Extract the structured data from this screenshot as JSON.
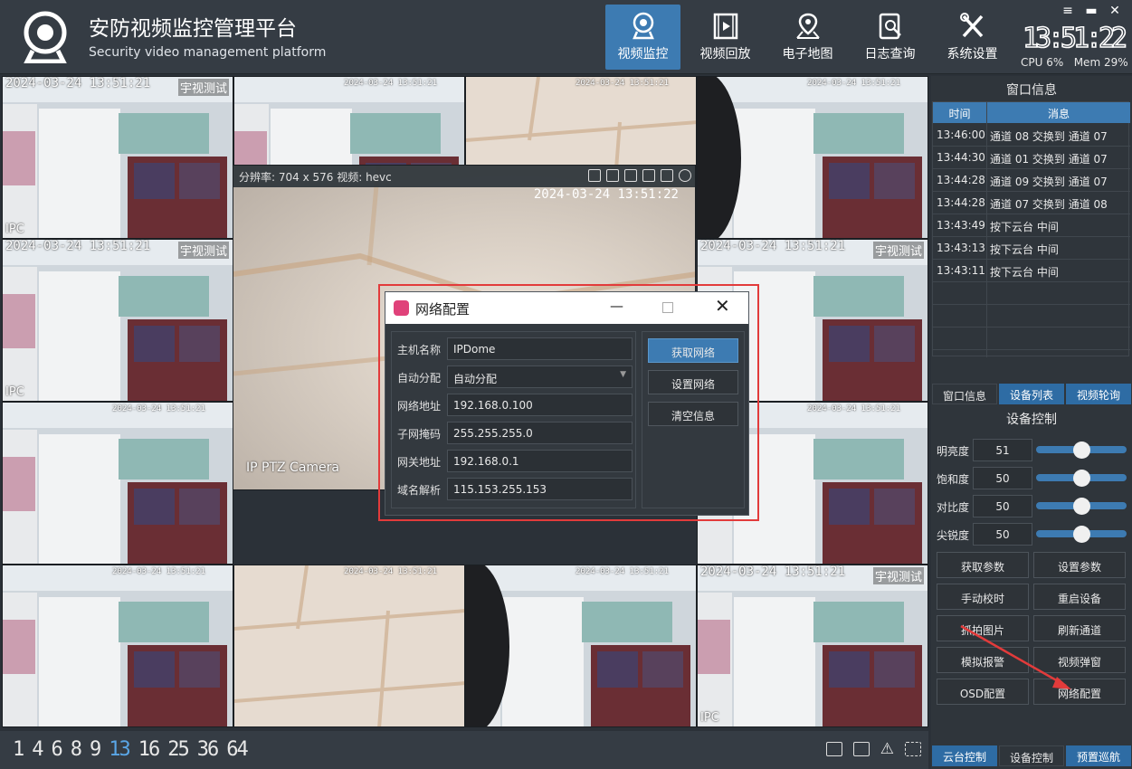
{
  "app": {
    "title": "安防视频监控管理平台",
    "subtitle": "Security video management platform"
  },
  "nav": [
    {
      "label": "视频监控",
      "icon": "camera-icon",
      "active": true
    },
    {
      "label": "视频回放",
      "icon": "film-icon",
      "active": false
    },
    {
      "label": "电子地图",
      "icon": "map-icon",
      "active": false
    },
    {
      "label": "日志查询",
      "icon": "log-search-icon",
      "active": false
    },
    {
      "label": "系统设置",
      "icon": "tools-icon",
      "active": false
    }
  ],
  "status": {
    "clock": "13:51:22",
    "cpu": "CPU 6%",
    "mem": "Mem 29%"
  },
  "cells": {
    "ts_main": "2024-03-24 13:51:21",
    "ts_small": "2024-03-24 13:51:21",
    "tag": "宇视测试",
    "ipc": "IPC"
  },
  "big_view": {
    "info": "分辨率: 704 x 576  视频: hevc",
    "timestamp": "2024-03-24 13:51:22",
    "camera_label": "IP PTZ Camera"
  },
  "dialog": {
    "title": "网络配置",
    "fields": [
      {
        "label": "主机名称",
        "value": "IPDome"
      },
      {
        "label": "自动分配",
        "value": "自动分配"
      },
      {
        "label": "网络地址",
        "value": "192.168.0.100"
      },
      {
        "label": "子网掩码",
        "value": "255.255.255.0"
      },
      {
        "label": "网关地址",
        "value": "192.168.0.1"
      },
      {
        "label": "域名解析",
        "value": "115.153.255.153"
      }
    ],
    "buttons": [
      "获取网络",
      "设置网络",
      "清空信息"
    ]
  },
  "layouts": [
    "1",
    "4",
    "6",
    "8",
    "9",
    "13",
    "16",
    "25",
    "36",
    "64"
  ],
  "layout_selected": "13",
  "right_panel": {
    "title": "窗口信息",
    "headers": [
      "时间",
      "消息"
    ],
    "rows": [
      {
        "time": "13:46:00",
        "msg": "通道 08 交换到 通道 07"
      },
      {
        "time": "13:44:30",
        "msg": "通道 01 交换到 通道 07"
      },
      {
        "time": "13:44:28",
        "msg": "通道 09 交换到 通道 07"
      },
      {
        "time": "13:44:28",
        "msg": "通道 07 交换到 通道 08"
      },
      {
        "time": "13:43:49",
        "msg": "按下云台 中间"
      },
      {
        "time": "13:43:13",
        "msg": "按下云台 中间"
      },
      {
        "time": "13:43:11",
        "msg": "按下云台 中间"
      }
    ],
    "tabs": [
      "窗口信息",
      "设备列表",
      "视频轮询"
    ],
    "device_title": "设备控制",
    "sliders": [
      {
        "label": "明亮度",
        "value": "51",
        "level": 0.51
      },
      {
        "label": "饱和度",
        "value": "50",
        "level": 0.5
      },
      {
        "label": "对比度",
        "value": "50",
        "level": 0.5
      },
      {
        "label": "尖锐度",
        "value": "50",
        "level": 0.5
      }
    ],
    "buttons": [
      "获取参数",
      "设置参数",
      "手动校时",
      "重启设备",
      "抓拍图片",
      "刷新通道",
      "模拟报警",
      "视频弹窗",
      "OSD配置",
      "网络配置"
    ],
    "bottom_tabs": [
      "云台控制",
      "设备控制",
      "预置巡航"
    ]
  },
  "colors": {
    "accent": "#3d7bb2",
    "header": "#353c44",
    "highlight": "#e23b3b"
  }
}
